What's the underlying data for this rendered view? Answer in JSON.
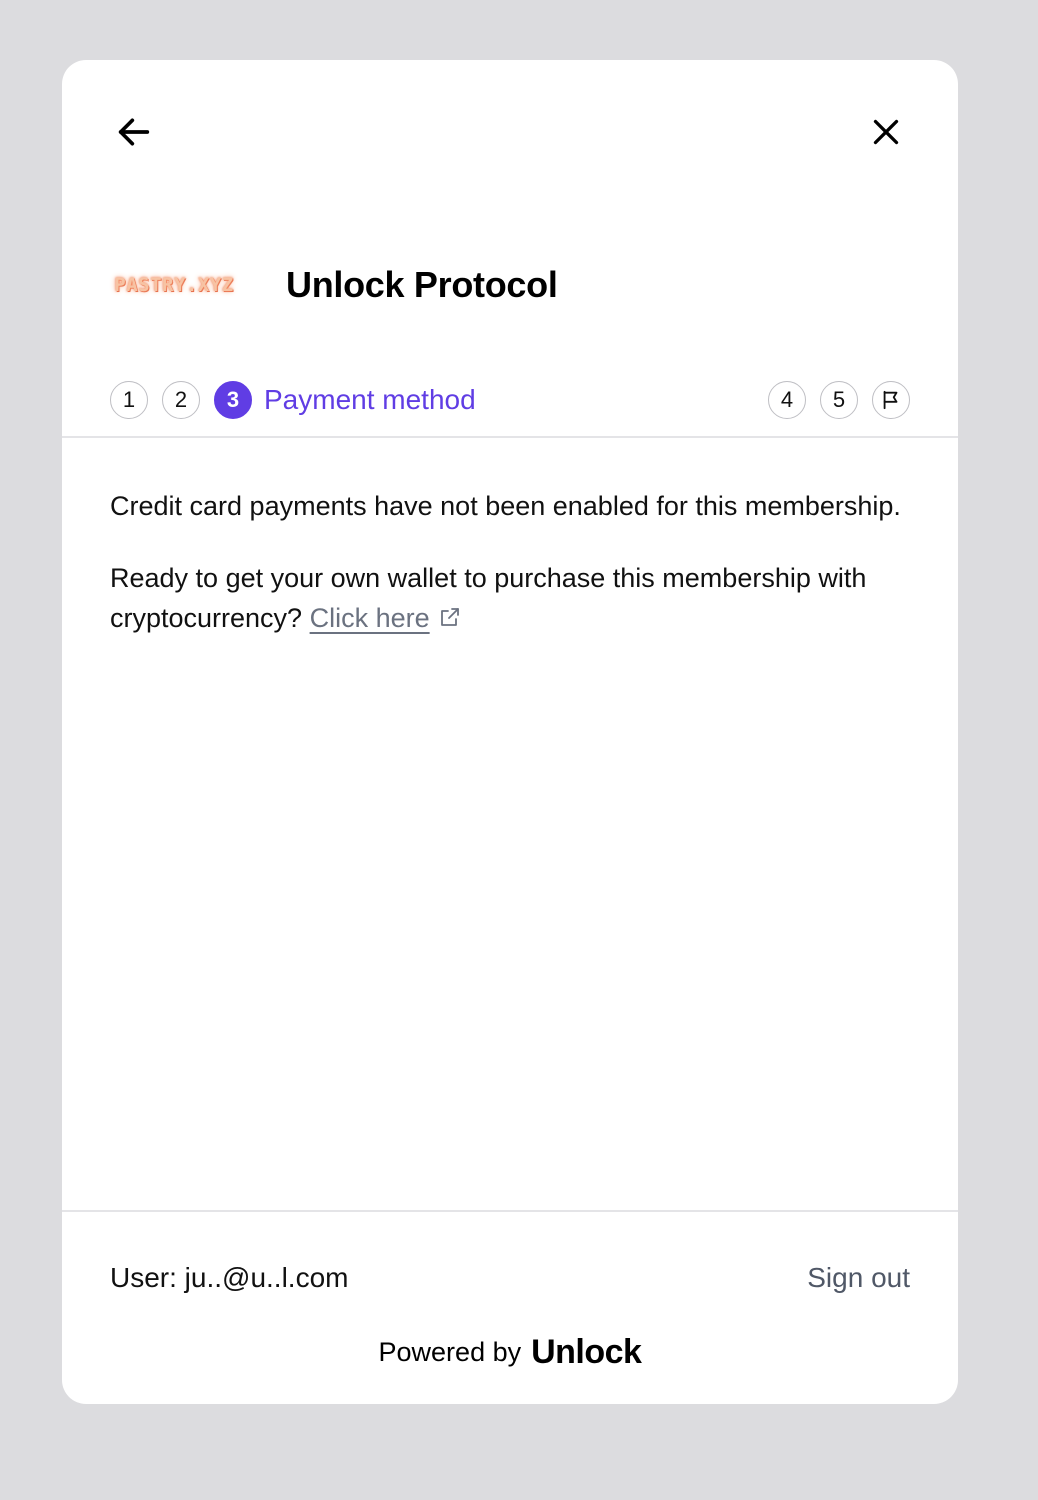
{
  "nav": {
    "back_icon": "arrow-left-icon",
    "close_icon": "close-icon"
  },
  "header": {
    "logo_text": "PASTRY.XYZ",
    "title": "Unlock Protocol"
  },
  "stepper": {
    "steps_before": [
      "1",
      "2"
    ],
    "active_step": "3",
    "active_label": "Payment method",
    "steps_after": [
      "4",
      "5"
    ],
    "final_icon": "flag-icon",
    "accent_color": "#603de4"
  },
  "content": {
    "notice": "Credit card payments have not been enabled for this membership.",
    "wallet_prompt": "Ready to get your own wallet to purchase this membership with cryptocurrency?",
    "link_label": "Click here",
    "link_icon": "external-link-icon"
  },
  "footer": {
    "user_label": "User: ju..@u..l.com",
    "signout_label": "Sign out",
    "powered_by": "Powered by",
    "brand": "Unlock"
  }
}
